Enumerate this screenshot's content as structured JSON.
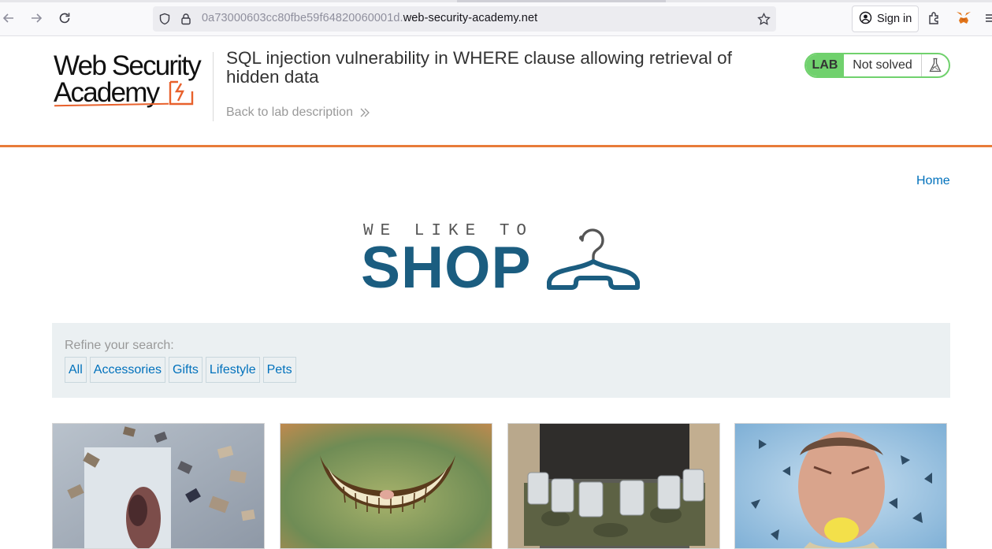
{
  "browser": {
    "url_prefix": "0a73000603cc80fbe59f64820060001d.",
    "url_domain": "web-security-academy.net",
    "signin_label": "Sign in",
    "icons": [
      "back-arrow-icon",
      "forward-arrow-icon",
      "reload-icon",
      "shield-icon",
      "lock-icon",
      "star-icon",
      "account-icon",
      "extensions-icon",
      "metamask-fox-icon",
      "menu-icon"
    ]
  },
  "lab_header": {
    "logo_line1": "Web Security",
    "logo_line2": "Academy",
    "title": "SQL injection vulnerability in WHERE clause allowing retrieval of hidden data",
    "back_link": "Back to lab description",
    "status_badge": "LAB",
    "status_text": "Not solved",
    "accent_color": "#e87b39",
    "status_color": "#70d16d"
  },
  "shop": {
    "home_link": "Home",
    "logo_tagline": "WE LIKE TO",
    "logo_word": "SHOP",
    "brand_color": "#1b5d80",
    "filter_label": "Refine your search:",
    "categories": [
      "All",
      "Accessories",
      "Gifts",
      "Lifestyle",
      "Pets"
    ],
    "products": [
      {
        "image": "flying-books-woman-image"
      },
      {
        "image": "cheshire-grin-image"
      },
      {
        "image": "beer-belt-image"
      },
      {
        "image": "man-biting-lemon-image"
      }
    ]
  }
}
